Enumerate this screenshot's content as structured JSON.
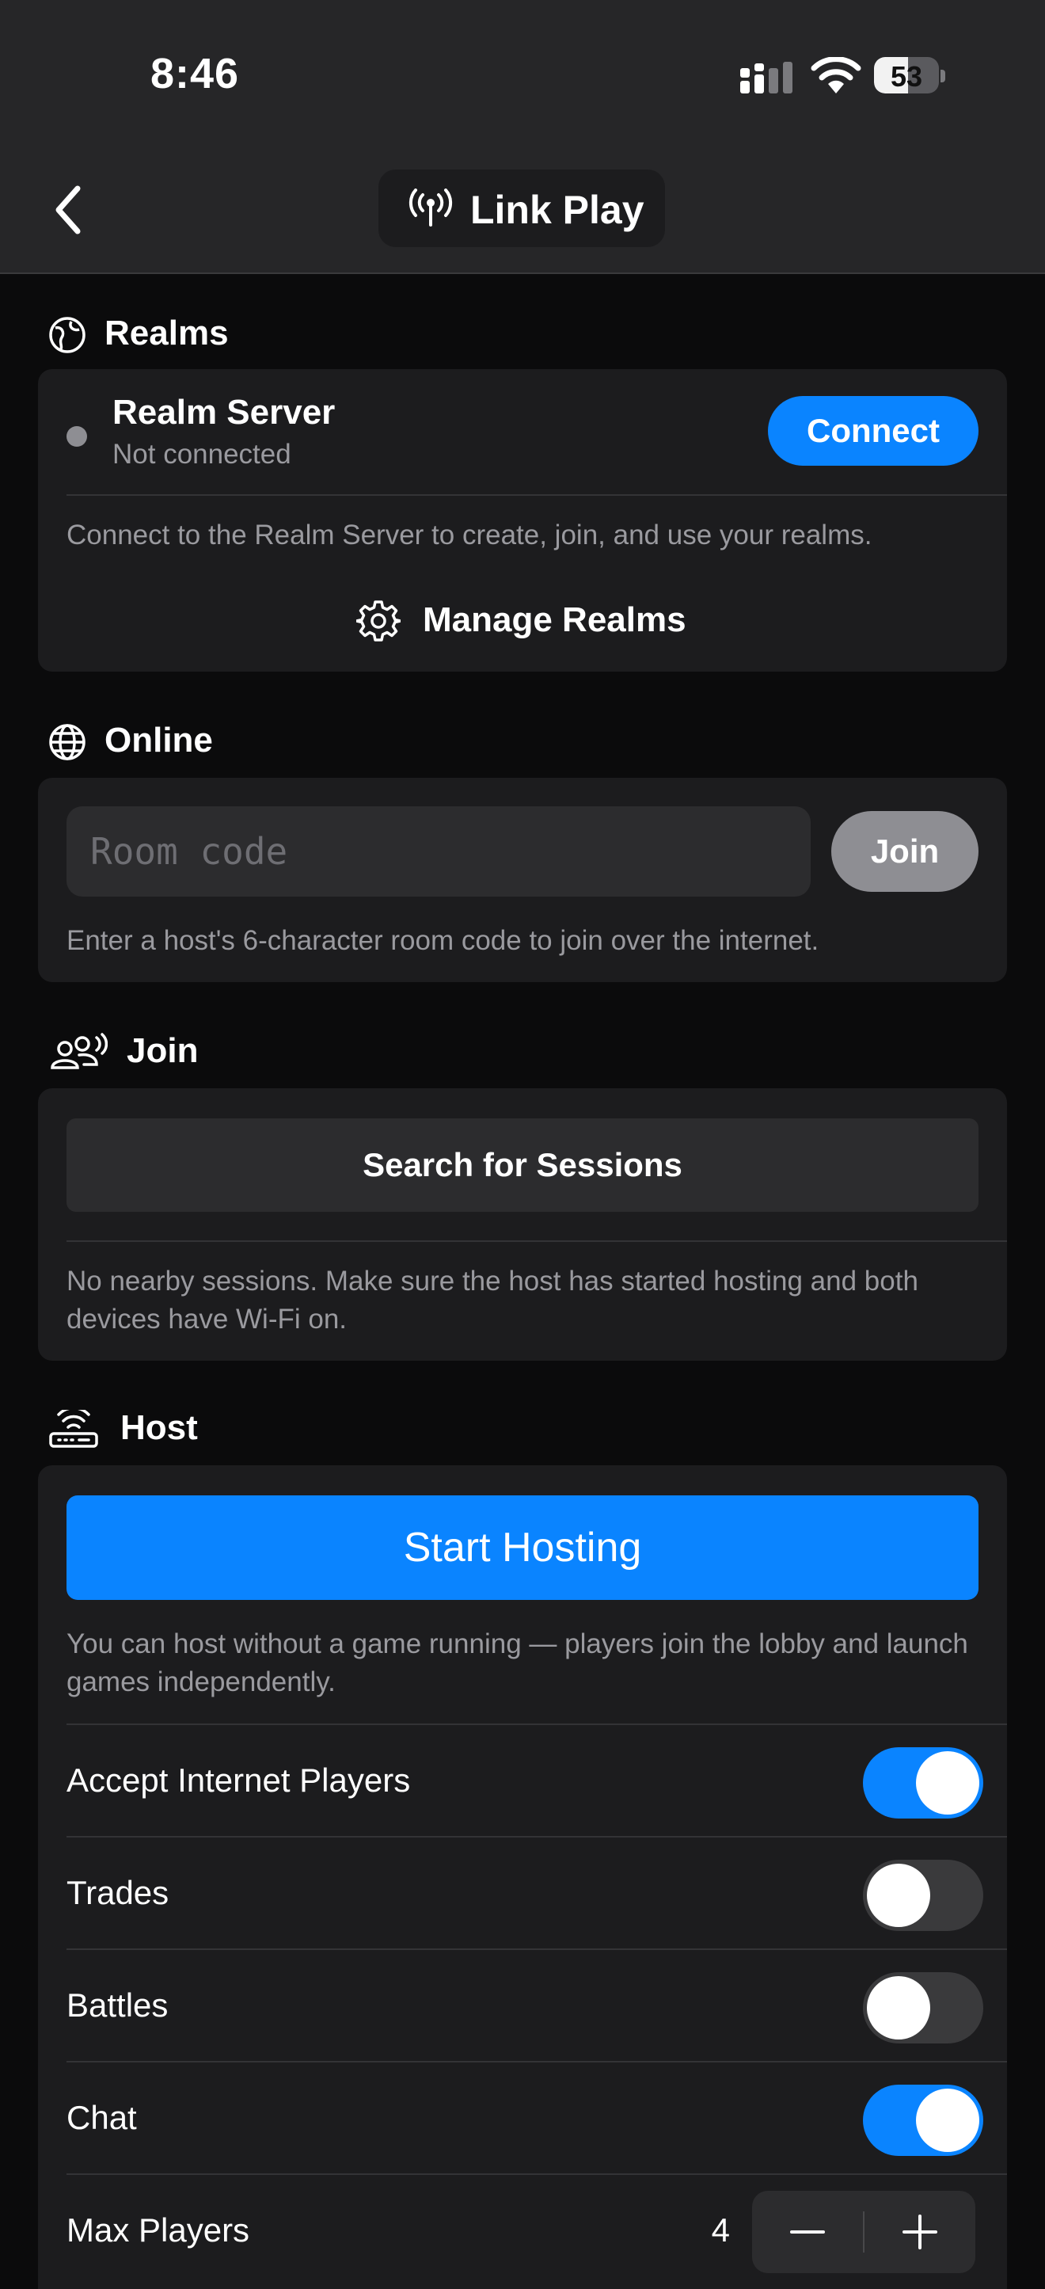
{
  "status_bar": {
    "time": "8:46",
    "battery": "53",
    "battery_level": 0.53
  },
  "nav": {
    "title": "Link Play"
  },
  "realms": {
    "heading": "Realms",
    "server_name": "Realm Server",
    "server_status": "Not connected",
    "connect_label": "Connect",
    "description": "Connect to the Realm Server to create, join, and use your realms.",
    "manage_label": "Manage Realms"
  },
  "online": {
    "heading": "Online",
    "room_code_placeholder": "Room code",
    "join_label": "Join",
    "description": "Enter a host's 6-character room code to join over the internet."
  },
  "join": {
    "heading": "Join",
    "search_label": "Search for Sessions",
    "description": "No nearby sessions. Make sure the host has started hosting and both devices have Wi-Fi on."
  },
  "host": {
    "heading": "Host",
    "start_label": "Start Hosting",
    "description": "You can host without a game running — players join the lobby and launch games independently.",
    "settings": [
      {
        "label": "Accept Internet Players",
        "on": true
      },
      {
        "label": "Trades",
        "on": false
      },
      {
        "label": "Battles",
        "on": false
      },
      {
        "label": "Chat",
        "on": true
      }
    ],
    "max_players_label": "Max Players",
    "max_players_value": "4"
  },
  "colors": {
    "accent": "#0a84ff",
    "card": "#1c1c1e",
    "background": "#0b0b0c"
  }
}
